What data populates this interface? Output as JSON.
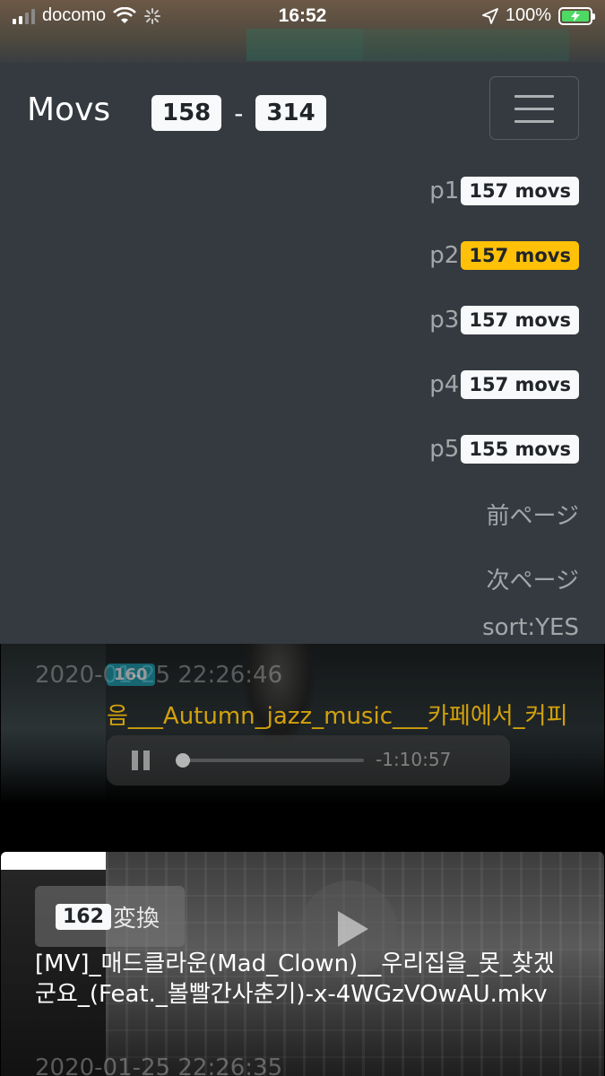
{
  "status_bar": {
    "carrier": "docomo",
    "time": "16:52",
    "battery": "100%",
    "battery_level": 1.0
  },
  "navbar": {
    "brand": "Movs",
    "range_start": "158",
    "range_sep": "-",
    "range_end": "314",
    "pages": [
      {
        "label": "p1",
        "count": "157 movs",
        "active": false
      },
      {
        "label": "p2",
        "count": "157 movs",
        "active": true
      },
      {
        "label": "p3",
        "count": "157 movs",
        "active": false
      },
      {
        "label": "p4",
        "count": "157 movs",
        "active": false
      },
      {
        "label": "p5",
        "count": "155 movs",
        "active": false
      }
    ],
    "prev_page": "前ページ",
    "next_page": "次ページ",
    "sort": "sort:YES"
  },
  "cards": [
    {
      "date": "2020-01-25 22:26:46",
      "number": "160",
      "title": "음___Autumn_jazz_music___카페에서_커피",
      "player_remaining": "-1:10:57"
    },
    {
      "number": "162",
      "convert_label": "変換",
      "filename": "[MV]_매드클라운(Mad_Clown)__우리집을_못_찾겠군요_(Feat._볼빨간사춘기)-x-4WGzVOwAU.mkv",
      "date": "2020-01-25 22:26:35"
    }
  ],
  "colors": {
    "navbar_bg": "#343a40",
    "active_badge": "#ffc107",
    "badge_light": "#f8f9fa",
    "info_badge": "#17a2b8"
  }
}
